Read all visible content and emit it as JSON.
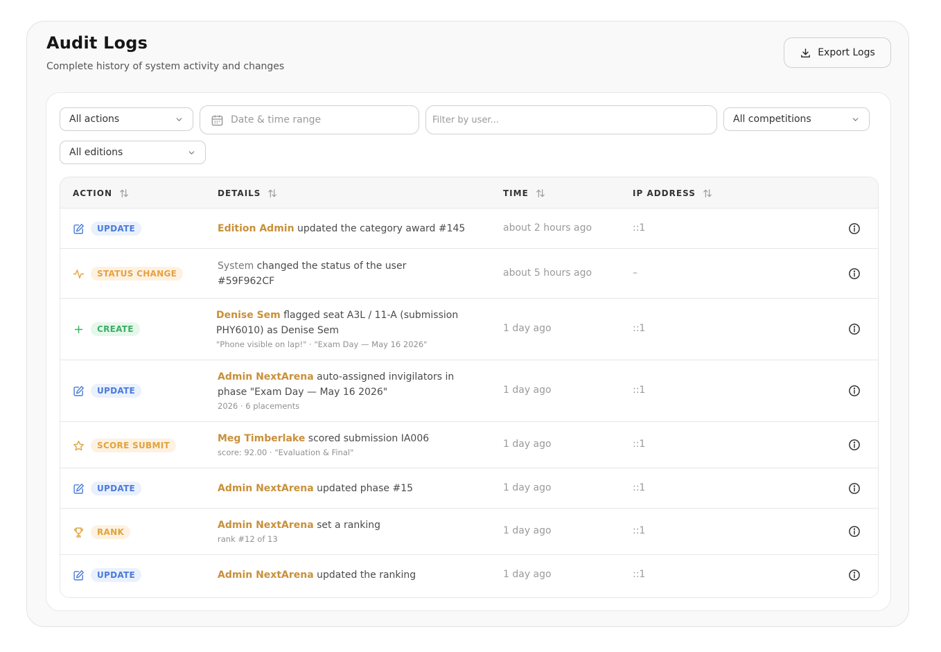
{
  "header": {
    "title": "Audit Logs",
    "subtitle": "Complete history of system activity and changes",
    "export_label": "Export Logs"
  },
  "filters": {
    "actions": "All actions",
    "date_placeholder": "Date & time range",
    "user_placeholder": "Filter by user...",
    "competitions": "All competitions",
    "editions": "All editions"
  },
  "table": {
    "columns": [
      "ACTION",
      "DETAILS",
      "TIME",
      "IP ADDRESS"
    ],
    "rows": [
      {
        "action": "UPDATE",
        "who": "Edition Admin",
        "text": " updated the category award #145",
        "sub": "",
        "time": "about 2 hours ago",
        "ip": "::1"
      },
      {
        "action": "STATUS CHANGE",
        "who": "System",
        "text": " changed the status of the user #59F962CF",
        "sub": "",
        "time": "about 5 hours ago",
        "ip": "–"
      },
      {
        "action": "CREATE",
        "who": "Denise Sem",
        "text": " flagged seat A3L / 11-A (submission PHY6010) as Denise Sem",
        "sub": "\"Phone visible on lap!\" · \"Exam Day — May 16 2026\"",
        "time": "1 day ago",
        "ip": "::1"
      },
      {
        "action": "UPDATE",
        "who": "Admin NextArena",
        "text": " auto-assigned invigilators in phase \"Exam Day — May 16 2026\"",
        "sub": "2026 · 6 placements",
        "time": "1 day ago",
        "ip": "::1"
      },
      {
        "action": "SCORE SUBMIT",
        "who": "Meg Timberlake",
        "text": "  scored submission IA006",
        "sub": "score: 92.00 · \"Evaluation & Final\"",
        "time": "1 day ago",
        "ip": "::1"
      },
      {
        "action": "UPDATE",
        "who": "Admin NextArena",
        "text": " updated phase #15",
        "sub": "",
        "time": "1 day ago",
        "ip": "::1"
      },
      {
        "action": "RANK",
        "who": "Admin NextArena",
        "text": " set a ranking",
        "sub": "rank #12 of 13",
        "time": "1 day ago",
        "ip": "::1"
      },
      {
        "action": "UPDATE",
        "who": "Admin NextArena",
        "text": " updated the ranking",
        "sub": "",
        "time": "1 day ago",
        "ip": "::1"
      }
    ]
  },
  "icons": {
    "update": "edit-icon",
    "status": "activity-icon",
    "create": "plus-icon",
    "score": "star-icon",
    "rank": "trophy-icon",
    "info": "info-icon",
    "export": "download-icon",
    "calendar": "calendar-icon",
    "sort": "sort-icon",
    "chevron": "chevron-down-icon"
  },
  "colors": {
    "update": "#4a7bd9",
    "status": "#e8a042",
    "create": "#3cae64",
    "accent_user": "#c8903a"
  }
}
